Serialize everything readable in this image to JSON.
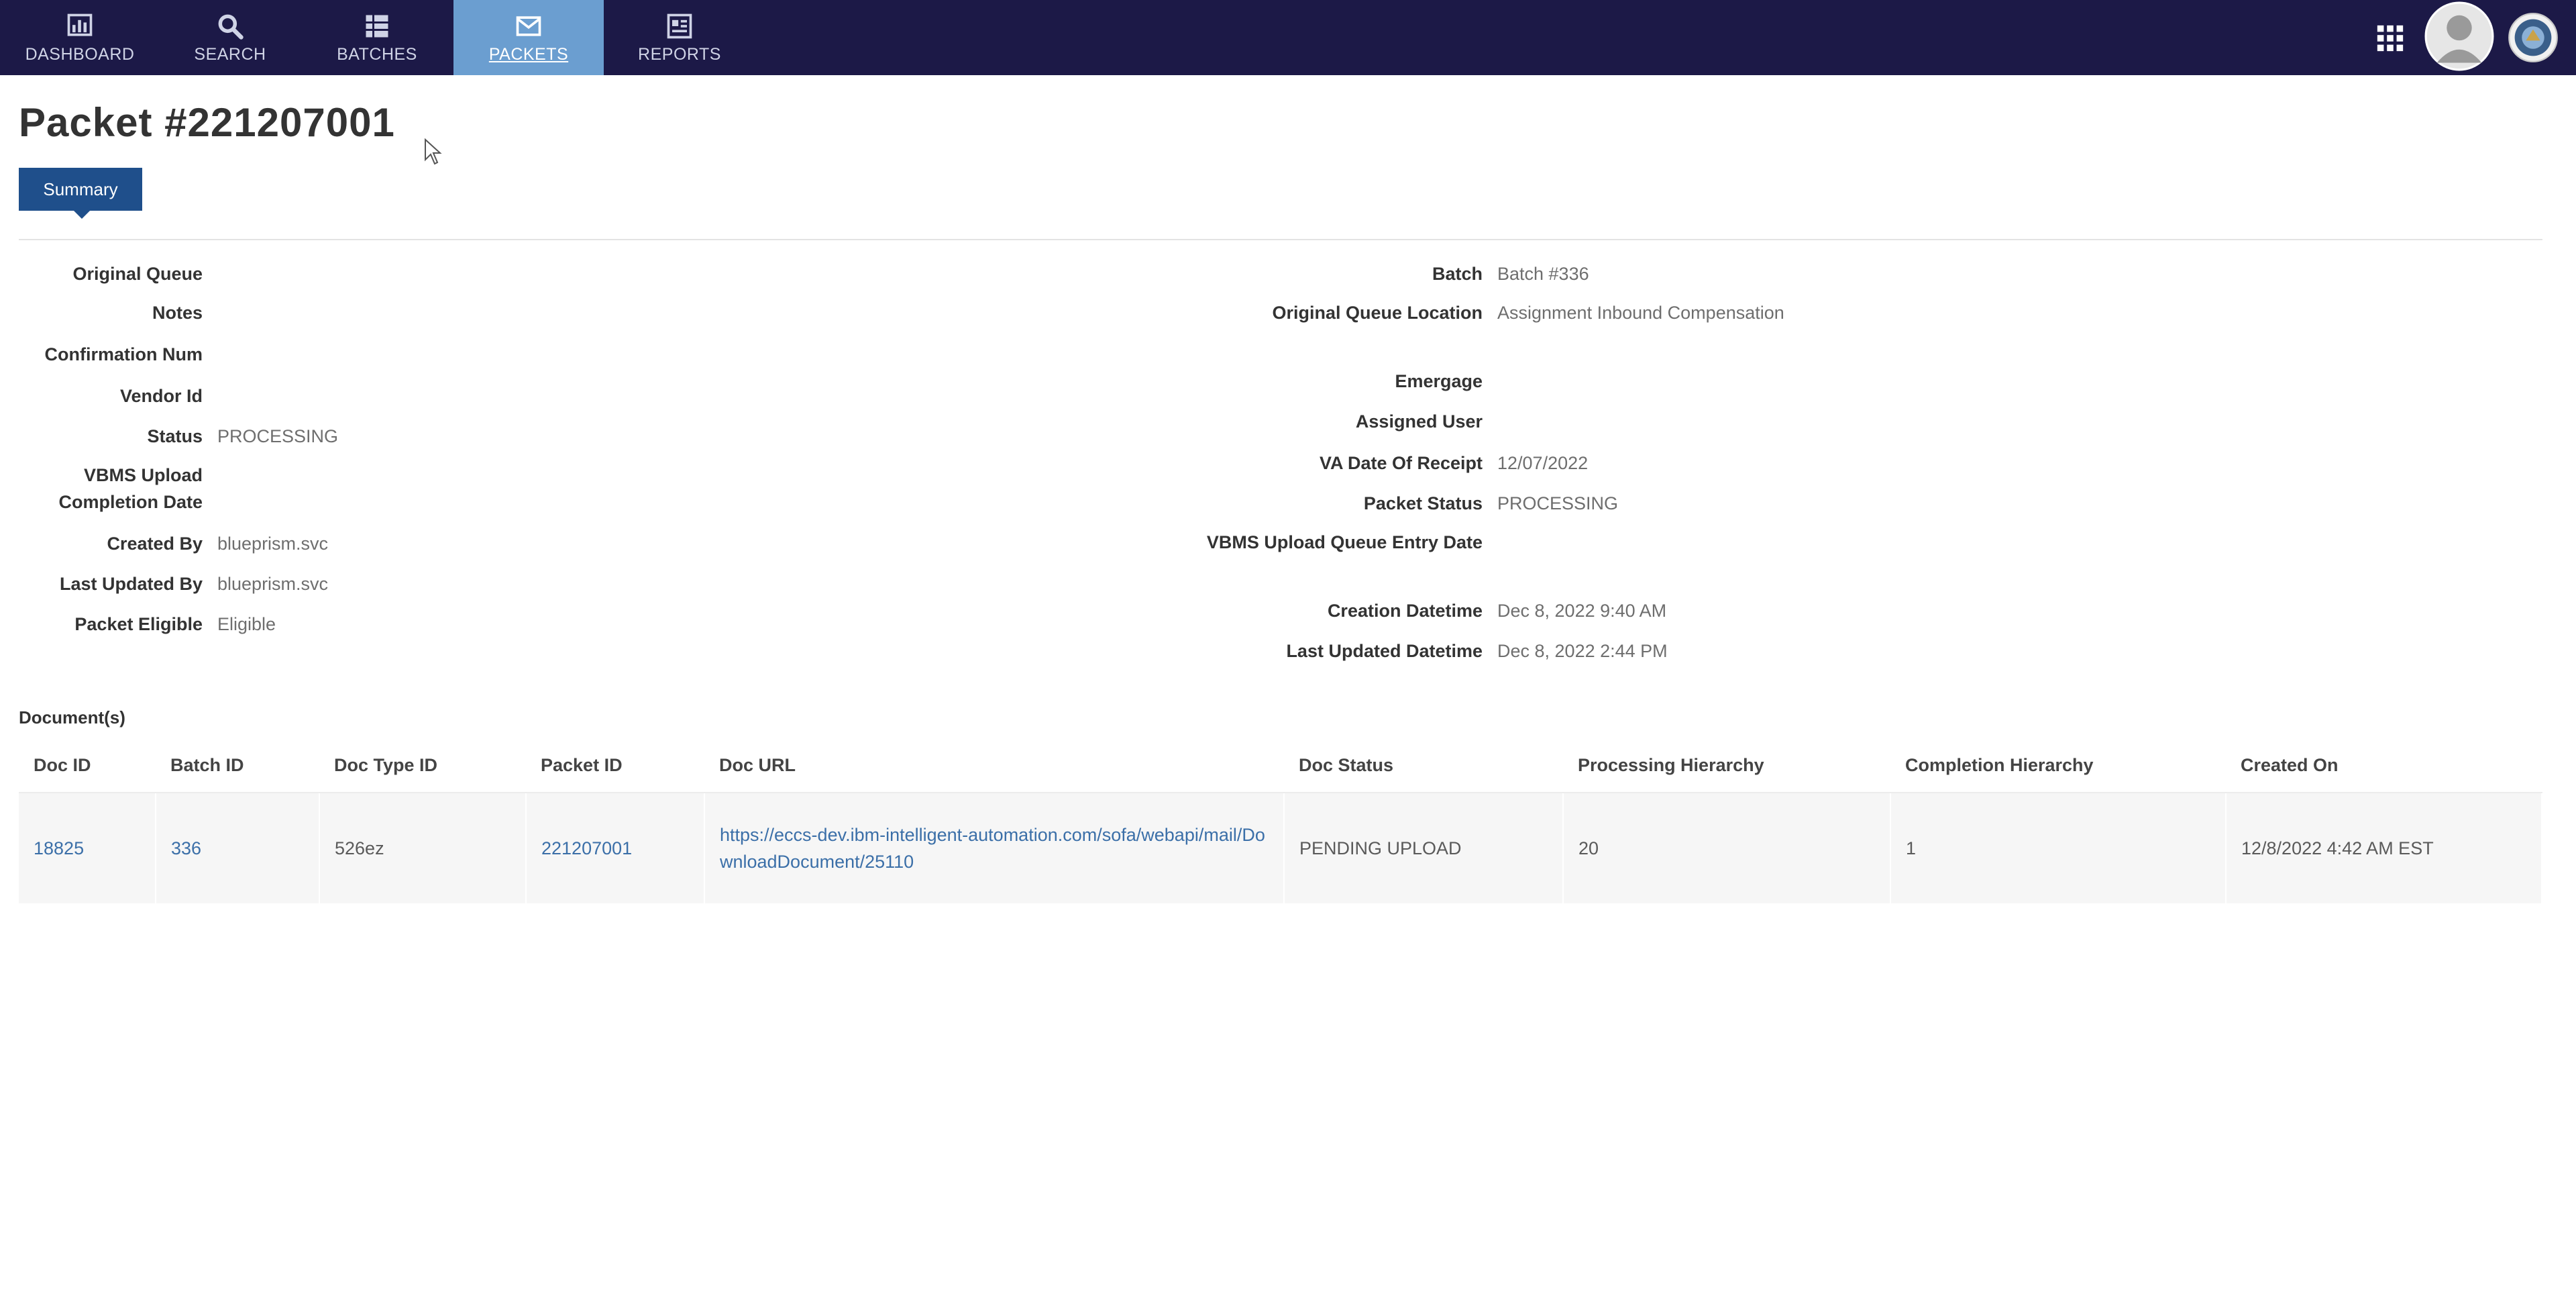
{
  "nav": {
    "items": [
      {
        "label": "DASHBOARD",
        "icon": "dashboard-chart-icon"
      },
      {
        "label": "SEARCH",
        "icon": "search-icon"
      },
      {
        "label": "BATCHES",
        "icon": "batches-grid-icon"
      },
      {
        "label": "PACKETS",
        "icon": "envelope-icon",
        "active": true
      },
      {
        "label": "REPORTS",
        "icon": "reports-icon"
      }
    ],
    "right_icons": [
      "apps-grid-icon",
      "user-avatar",
      "agency-seal-icon"
    ],
    "colors": {
      "bar": "#1c1947",
      "active": "#6b9ed0"
    }
  },
  "page": {
    "title": "Packet #221207001",
    "tab": "Summary"
  },
  "left_fields": [
    {
      "label": "Original Queue",
      "value": ""
    },
    {
      "label": "Notes",
      "value": ""
    },
    {
      "label": "Confirmation Num",
      "value": ""
    },
    {
      "label": "Vendor Id",
      "value": ""
    },
    {
      "label": "Status",
      "value": "PROCESSING"
    },
    {
      "label": "VBMS Upload Completion Date",
      "value": ""
    },
    {
      "label": "Created By",
      "value": "blueprism.svc"
    },
    {
      "label": "Last Updated By",
      "value": "blueprism.svc"
    },
    {
      "label": "Packet Eligible",
      "value": "Eligible"
    }
  ],
  "right_fields": [
    {
      "label": "Batch",
      "value": "Batch #336"
    },
    {
      "label": "Original Queue Location",
      "value": "Assignment Inbound Compensation"
    },
    {
      "label": "Emergage",
      "value": ""
    },
    {
      "label": "Assigned User",
      "value": ""
    },
    {
      "label": "VA Date Of Receipt",
      "value": "12/07/2022"
    },
    {
      "label": "Packet Status",
      "value": "PROCESSING"
    },
    {
      "label": "VBMS Upload Queue Entry Date",
      "value": ""
    },
    {
      "label": "Creation Datetime",
      "value": "Dec 8, 2022 9:40 AM"
    },
    {
      "label": "Last Updated Datetime",
      "value": "Dec 8, 2022 2:44 PM"
    }
  ],
  "documents": {
    "heading": "Document(s)",
    "columns": [
      "Doc ID",
      "Batch ID",
      "Doc Type ID",
      "Packet ID",
      "Doc URL",
      "Doc Status",
      "Processing Hierarchy",
      "Completion Hierarchy",
      "Created On"
    ],
    "rows": [
      {
        "doc_id": "18825",
        "batch_id": "336",
        "doc_type_id": "526ez",
        "packet_id": "221207001",
        "doc_url": "https://eccs-dev.ibm-intelligent-automation.com/sofa/webapi/mail/DownloadDocument/25110",
        "doc_status": "PENDING UPLOAD",
        "processing_hierarchy": "20",
        "completion_hierarchy": "1",
        "created_on": "12/8/2022 4:42 AM EST"
      }
    ]
  }
}
